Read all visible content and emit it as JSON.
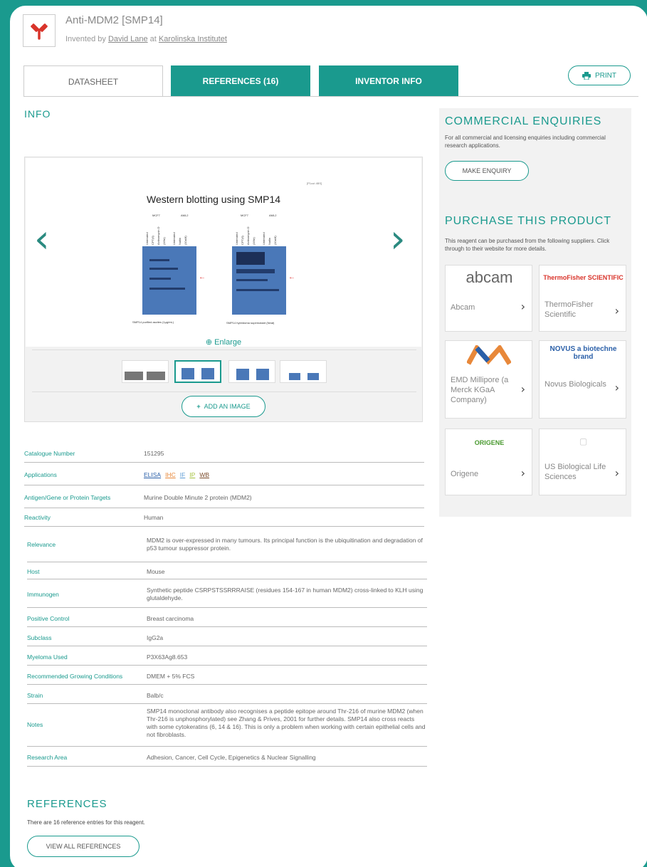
{
  "header": {
    "title": "Anti-MDM2 [SMP14]",
    "invented_prefix": "Invented by",
    "inventor": "David Lane",
    "at": "at",
    "institute": "Karolinska Institutet"
  },
  "tabs": [
    {
      "label": "DATASHEET",
      "active": true
    },
    {
      "label": "REFERENCES (16)",
      "active": false
    },
    {
      "label": "INVENTOR INFO",
      "active": false
    }
  ],
  "print_label": "PRINT",
  "info_heading": "INFO",
  "gallery": {
    "main_title": "Western blotting using SMP14",
    "small_label": "[P1cut 4BS]",
    "caption_left": "SMP14 purified ascites (1μg/mL)",
    "caption_right": "SMP14 hybridoma supernatant (Neat)",
    "group_label_a": "MCF7",
    "group_label_b": "AML2",
    "lanes": [
      "Untreated",
      "CPT(6)",
      "Actinomycin D",
      "(16hr)",
      "Untreated",
      "Nutlin",
      "(10uM)"
    ],
    "enlarge_label": "Enlarge",
    "add_image_label": "ADD AN IMAGE"
  },
  "details": [
    {
      "key": "Catalogue Number",
      "value": "151295"
    },
    {
      "key": "Applications",
      "value": ""
    },
    {
      "key": "Antigen/Gene or Protein Targets",
      "value": "Murine Double Minute 2 protein (MDM2)"
    },
    {
      "key": "Reactivity",
      "value": "Human"
    },
    {
      "key": "Relevance",
      "value": "MDM2 is over-expressed in many tumours. Its principal function is the ubiquitination and degradation of p53 tumour suppressor protein."
    },
    {
      "key": "Host",
      "value": "Mouse"
    },
    {
      "key": "Immunogen",
      "value": "Synthetic peptide CSRPSTSSRRRAISE (residues 154-167 in human MDM2) cross-linked to KLH using glutaldehyde."
    },
    {
      "key": "Positive Control",
      "value": "Breast carcinoma"
    },
    {
      "key": "Subclass",
      "value": "IgG2a"
    },
    {
      "key": "Myeloma Used",
      "value": "P3X63Ag8.653"
    },
    {
      "key": "Recommended Growing Conditions",
      "value": "DMEM + 5% FCS"
    },
    {
      "key": "Strain",
      "value": "Balb/c"
    },
    {
      "key": "Notes",
      "value": "SMP14 monoclonal antibody also recognises a peptide epitope around Thr-216 of murine MDM2 (when Thr-216 is unphosphorylated) see Zhang & Prives, 2001 for further details. SMP14 also cross reacts with some cytokeratins (6, 14 & 16). This is only a problem when working with certain epithelial cells and not fibroblasts."
    },
    {
      "key": "Research Area",
      "value": "Adhesion, Cancer, Cell Cycle, Epigenetics & Nuclear Signalling"
    }
  ],
  "applications": [
    {
      "label": "ELISA",
      "color": "#2a5fa8"
    },
    {
      "label": "IHC",
      "color": "#e8883a"
    },
    {
      "label": "IF",
      "color": "#5b9bd5"
    },
    {
      "label": "IP",
      "color": "#a6c23e"
    },
    {
      "label": "WB",
      "color": "#7a4a2a"
    }
  ],
  "sidebar": {
    "commercial_heading": "COMMERCIAL ENQUIRIES",
    "commercial_text": "For all commercial and licensing enquiries including commercial research applications.",
    "enquiry_button": "MAKE ENQUIRY",
    "purchase_heading": "PURCHASE THIS PRODUCT",
    "purchase_text": "This reagent can be purchased from the following suppliers. Click through to their website for more details.",
    "suppliers": [
      {
        "logo": "abcam",
        "name": "Abcam"
      },
      {
        "logo": "ThermoFisher SCIENTIFIC",
        "name": "ThermoFisher Scientific"
      },
      {
        "logo": "M",
        "name": "EMD Millipore (a Merck KGaA Company)"
      },
      {
        "logo": "NOVUS a biotechne brand",
        "name": "Novus Biologicals"
      },
      {
        "logo": "ORIGENE",
        "name": "Origene"
      },
      {
        "logo": "",
        "name": "US Biological Life Sciences"
      }
    ]
  },
  "references": {
    "heading": "REFERENCES",
    "text": "There are 16 reference entries for this reagent.",
    "button": "VIEW ALL REFERENCES"
  },
  "colors": {
    "accent": "#1a9a8e",
    "logo_red": "#d9342b"
  }
}
